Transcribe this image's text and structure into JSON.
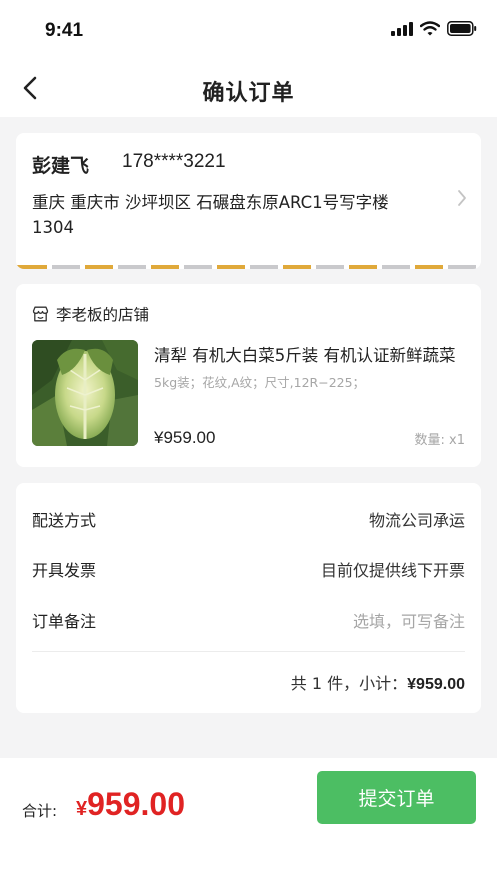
{
  "status_bar": {
    "time": "9:41"
  },
  "nav": {
    "title": "确认订单"
  },
  "address": {
    "name": "彭建飞",
    "phone": "178****3221",
    "detail": "重庆 重庆市 沙坪坝区 石碾盘东原ARC1号写字楼1304"
  },
  "shop": {
    "name": "李老板的店铺",
    "product": {
      "title": "清犁 有机大白菜5斤装 有机认证新鲜蔬菜",
      "spec": "5kg装；花纹,A纹；尺寸,12R−225；",
      "price": "¥959.00",
      "qty": "数量: x1"
    }
  },
  "order_info": {
    "rows": [
      {
        "label": "配送方式",
        "value": "物流公司承运"
      },
      {
        "label": "开具发票",
        "value": "目前仅提供线下开票"
      },
      {
        "label": "订单备注",
        "value": "选填，可写备注"
      }
    ],
    "summary_prefix": "共 1 件，小计：",
    "summary_amount": "¥959.00"
  },
  "footer": {
    "total_label": "合计:",
    "currency": "¥",
    "amount": "959.00",
    "submit_label": "提交订单"
  },
  "colors": {
    "accent_green": "#4cbe63",
    "price_red": "#e02323",
    "stripe_orange": "#e0a93a"
  },
  "icons": [
    "back-chevron-icon",
    "chevron-right-icon",
    "shop-icon",
    "signal-icon",
    "wifi-icon",
    "battery-icon"
  ]
}
